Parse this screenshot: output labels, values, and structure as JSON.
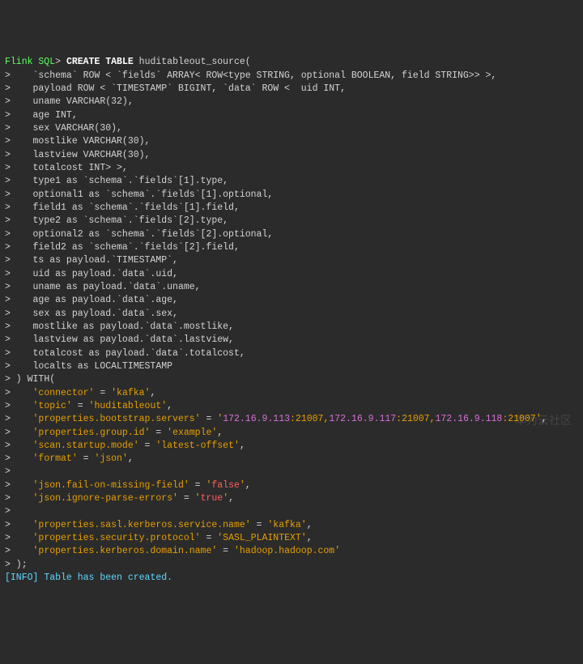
{
  "prompt": {
    "label": "Flink SQL",
    "continuation": ">"
  },
  "sql": {
    "head": {
      "pre": " ",
      "kw": "CREATE TABLE",
      "post": " huditableout_source("
    },
    "cols": [
      "    `schema` ROW < `fields` ARRAY< ROW<type STRING, optional BOOLEAN, field STRING>> >,",
      "    payload ROW < `TIMESTAMP` BIGINT, `data` ROW <  uid INT,",
      "    uname VARCHAR(32),",
      "    age INT,",
      "    sex VARCHAR(30),",
      "    mostlike VARCHAR(30),",
      "    lastview VARCHAR(30),",
      "    totalcost INT> >,",
      "    type1 as `schema`.`fields`[1].type,",
      "    optional1 as `schema`.`fields`[1].optional,",
      "    field1 as `schema`.`fields`[1].field,",
      "    type2 as `schema`.`fields`[2].type,",
      "    optional2 as `schema`.`fields`[2].optional,",
      "    field2 as `schema`.`fields`[2].field,",
      "    ts as payload.`TIMESTAMP`,",
      "    uid as payload.`data`.uid,",
      "    uname as payload.`data`.uname,",
      "    age as payload.`data`.age,",
      "    sex as payload.`data`.sex,",
      "    mostlike as payload.`data`.mostlike,",
      "    lastview as payload.`data`.lastview,",
      "    totalcost as payload.`data`.totalcost,",
      "    localts as LOCALTIMESTAMP"
    ],
    "with_open": " ) WITH(",
    "kv_simple": [
      {
        "k": "'connector'",
        "eq": " = ",
        "v": "'kafka'",
        "tail": ","
      },
      {
        "k": "'topic'",
        "eq": " = ",
        "v": "'huditableout'",
        "tail": ","
      }
    ],
    "bootstrap": {
      "k": "'properties.bootstrap.servers'",
      "eq": " = ",
      "q1": "'",
      "ip1": "172.16.9.113",
      "port1": ":21007",
      "sep1": ",",
      "ip2": "172.16.9.117",
      "port2": ":21007",
      "sep2": ",",
      "ip3": "172.16.9.118",
      "port3": ":21007",
      "q2": "'",
      "tail": ","
    },
    "kv_simple2": [
      {
        "k": "'properties.group.id'",
        "eq": " = ",
        "v": "'example'",
        "tail": ","
      },
      {
        "k": "'scan.startup.mode'",
        "eq": " = ",
        "v": "'latest-offset'",
        "tail": ","
      },
      {
        "k": "'format'",
        "eq": " = ",
        "v": "'json'",
        "tail": ","
      }
    ],
    "blank": "",
    "kv_bool": [
      {
        "k": "'json.fail-on-missing-field'",
        "eq": " = ",
        "q1": "'",
        "b": "false",
        "q2": "'",
        "tail": ","
      },
      {
        "k": "'json.ignore-parse-errors'",
        "eq": " = ",
        "q1": "'",
        "b": "true",
        "q2": "'",
        "tail": ","
      }
    ],
    "kv_simple3": [
      {
        "k": "'properties.sasl.kerberos.service.name'",
        "eq": " = ",
        "v": "'kafka'",
        "tail": ","
      },
      {
        "k": "'properties.security.protocol'",
        "eq": " = ",
        "v": "'SASL_PLAINTEXT'",
        "tail": ","
      },
      {
        "k": "'properties.kerberos.domain.name'",
        "eq": " = ",
        "v": "'hadoop.hadoop.com'",
        "tail": ""
      }
    ],
    "close": " );"
  },
  "info": {
    "tag": "[INFO]",
    "msg": " Table has been created."
  },
  "watermark": "华为云社区"
}
